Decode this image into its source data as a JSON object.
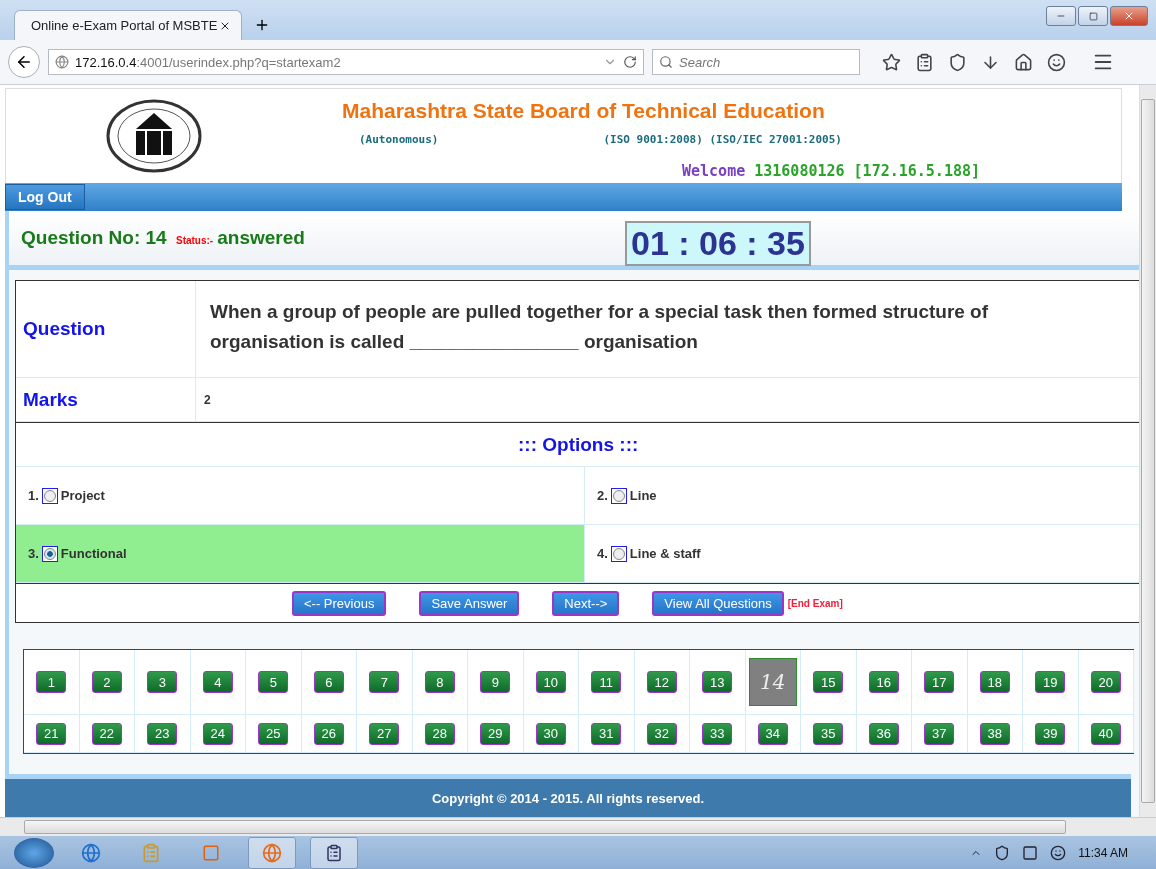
{
  "browser": {
    "tab_title": "Online e-Exam Portal of MSBTE",
    "url_host": "172.16.0.4",
    "url_rest": ":4001/userindex.php?q=startexam2",
    "search_placeholder": "Search"
  },
  "header": {
    "title": "Maharashtra State Board of Technical Education",
    "autonomous": "(Autonomous)",
    "iso": "(ISO 9001:2008) (ISO/IEC 27001:2005)",
    "welcome_label": "Welcome",
    "welcome_user": "1316080126 [172.16.5.188]"
  },
  "nav": {
    "logout": "Log Out"
  },
  "status_line": {
    "question_no": "Question No: 14",
    "status_label": "Status:-",
    "status": "answered",
    "timer": "01 : 06 : 35"
  },
  "question": {
    "label": "Question",
    "text": "When a group of people are pulled together for a special task then formed structure of organisation is called ________________ organisation",
    "marks_label": "Marks",
    "marks": "2"
  },
  "options_title": "::: Options :::",
  "options": [
    {
      "number": "1.",
      "label": "Project",
      "selected": false
    },
    {
      "number": "2.",
      "label": "Line",
      "selected": false
    },
    {
      "number": "3.",
      "label": "Functional",
      "selected": true
    },
    {
      "number": "4.",
      "label": "Line & staff",
      "selected": false
    }
  ],
  "buttons": [
    "<-- Previous",
    "Save Answer",
    "Next-->",
    "View All Questions"
  ],
  "end_exam": "[End Exam]",
  "question_grid": [
    {
      "label": "1",
      "selected": false
    },
    {
      "label": "2",
      "selected": false
    },
    {
      "label": "3",
      "selected": false
    },
    {
      "label": "4",
      "selected": false
    },
    {
      "label": "5",
      "selected": false
    },
    {
      "label": "6",
      "selected": false
    },
    {
      "label": "7",
      "selected": false
    },
    {
      "label": "8",
      "selected": false
    },
    {
      "label": "9",
      "selected": false
    },
    {
      "label": "10",
      "selected": false
    },
    {
      "label": "11",
      "selected": false
    },
    {
      "label": "12",
      "selected": false
    },
    {
      "label": "13",
      "selected": false
    },
    {
      "label": "14",
      "selected": true
    },
    {
      "label": "15",
      "selected": false
    },
    {
      "label": "16",
      "selected": false
    },
    {
      "label": "17",
      "selected": false
    },
    {
      "label": "18",
      "selected": false
    },
    {
      "label": "19",
      "selected": false
    },
    {
      "label": "20",
      "selected": false
    },
    {
      "label": "21",
      "selected": false
    },
    {
      "label": "22",
      "selected": false
    },
    {
      "label": "23",
      "selected": false
    },
    {
      "label": "24",
      "selected": false
    },
    {
      "label": "25",
      "selected": false
    },
    {
      "label": "26",
      "selected": false
    },
    {
      "label": "27",
      "selected": false
    },
    {
      "label": "28",
      "selected": false
    },
    {
      "label": "29",
      "selected": false
    },
    {
      "label": "30",
      "selected": false
    },
    {
      "label": "31",
      "selected": false
    },
    {
      "label": "32",
      "selected": false
    },
    {
      "label": "33",
      "selected": false
    },
    {
      "label": "34",
      "selected": false
    },
    {
      "label": "35",
      "selected": false
    },
    {
      "label": "36",
      "selected": false
    },
    {
      "label": "37",
      "selected": false
    },
    {
      "label": "38",
      "selected": false
    },
    {
      "label": "39",
      "selected": false
    },
    {
      "label": "40",
      "selected": false
    }
  ],
  "footer": "Copyright © 2014 - 2015. All rights reserved.",
  "taskbar": {
    "clock": "11:34 AM"
  }
}
